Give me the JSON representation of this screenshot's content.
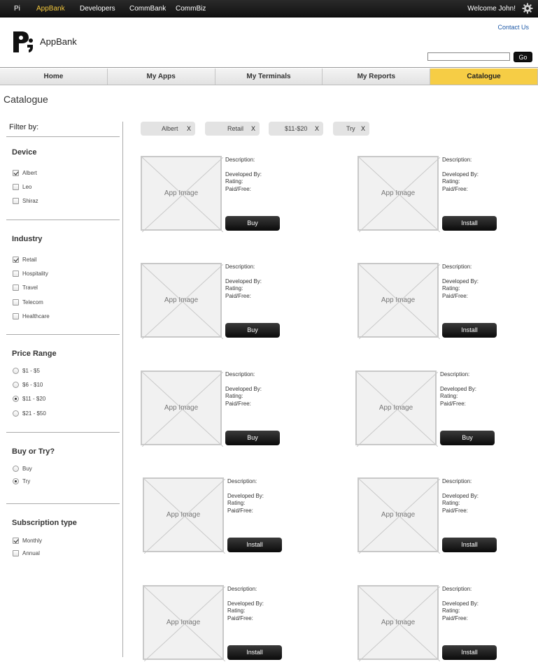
{
  "topnav": {
    "items": [
      {
        "label": "Pi",
        "active": false
      },
      {
        "label": "AppBank",
        "active": true
      },
      {
        "label": "Developers",
        "active": false
      },
      {
        "label": "CommBank",
        "active": false
      },
      {
        "label": "CommBiz",
        "active": false
      }
    ],
    "welcome": "Welcome John!",
    "settings_icon": "gear-icon"
  },
  "header": {
    "brand": "AppBank",
    "contact_link": "Contact Us",
    "search_placeholder": "",
    "go_label": "Go"
  },
  "tabs": [
    {
      "label": "Home",
      "active": false
    },
    {
      "label": "My Apps",
      "active": false
    },
    {
      "label": "My Terminals",
      "active": false
    },
    {
      "label": "My Reports",
      "active": false
    },
    {
      "label": "Catalogue",
      "active": true
    }
  ],
  "page_title": "Catalogue",
  "sidebar": {
    "filter_by": "Filter by:",
    "device": {
      "title": "Device",
      "options": [
        {
          "label": "Albert",
          "checked": true
        },
        {
          "label": "Leo",
          "checked": false
        },
        {
          "label": "Shiraz",
          "checked": false
        }
      ]
    },
    "industry": {
      "title": "Industry",
      "options": [
        {
          "label": "Retail",
          "checked": true
        },
        {
          "label": "Hospitality",
          "checked": false
        },
        {
          "label": "Travel",
          "checked": false
        },
        {
          "label": "Telecom",
          "checked": false
        },
        {
          "label": "Healthcare",
          "checked": false
        }
      ]
    },
    "price_range": {
      "title": "Price Range",
      "options": [
        {
          "label": "$1 - $5",
          "checked": false
        },
        {
          "label": "$6 - $10",
          "checked": false
        },
        {
          "label": "$11 - $20",
          "checked": true
        },
        {
          "label": "$21 - $50",
          "checked": false
        }
      ]
    },
    "buy_or_try": {
      "title": "Buy or Try?",
      "options": [
        {
          "label": "Buy",
          "checked": false
        },
        {
          "label": "Try",
          "checked": true
        }
      ]
    },
    "subscription": {
      "title": "Subscription type",
      "options": [
        {
          "label": "Monthly",
          "checked": true
        },
        {
          "label": "Annual",
          "checked": false
        }
      ]
    }
  },
  "active_filters": [
    {
      "label": "Albert",
      "remove": "X"
    },
    {
      "label": "Retail",
      "remove": "X"
    },
    {
      "label": "$11-$20",
      "remove": "X"
    },
    {
      "label": "Try",
      "remove": "X"
    }
  ],
  "apps": [
    {
      "image_label": "App Image",
      "description": "Description:",
      "developed_by": "Developed By:",
      "rating": "Rating:",
      "paid_free": "Paid/Free:",
      "button": "Buy"
    },
    {
      "image_label": "App Image",
      "description": "Description:",
      "developed_by": "Developed By:",
      "rating": "Rating:",
      "paid_free": "Paid/Free:",
      "button": "Install"
    },
    {
      "image_label": "App Image",
      "description": "Description:",
      "developed_by": "Developed By:",
      "rating": "Rating:",
      "paid_free": "Paid/Free:",
      "button": "Buy"
    },
    {
      "image_label": "App Image",
      "description": "Description:",
      "developed_by": "Developed By:",
      "rating": "Rating:",
      "paid_free": "Paid/Free:",
      "button": "Install"
    },
    {
      "image_label": "App Image",
      "description": "Description:",
      "developed_by": "Developed By:",
      "rating": "Rating:",
      "paid_free": "Paid/Free:",
      "button": "Buy"
    },
    {
      "image_label": "App Image",
      "description": "Description:",
      "developed_by": "Developed By:",
      "rating": "Rating:",
      "paid_free": "Paid/Free:",
      "button": "Buy"
    },
    {
      "image_label": "App Image",
      "description": "Description:",
      "developed_by": "Developed By:",
      "rating": "Rating:",
      "paid_free": "Paid/Free:",
      "button": "Install"
    },
    {
      "image_label": "App Image",
      "description": "Description:",
      "developed_by": "Developed By:",
      "rating": "Rating:",
      "paid_free": "Paid/Free:",
      "button": "Install"
    },
    {
      "image_label": "App Image",
      "description": "Description:",
      "developed_by": "Developed By:",
      "rating": "Rating:",
      "paid_free": "Paid/Free:",
      "button": "Install"
    },
    {
      "image_label": "App Image",
      "description": "Description:",
      "developed_by": "Developed By:",
      "rating": "Rating:",
      "paid_free": "Paid/Free:",
      "button": "Install"
    }
  ],
  "colors": {
    "accent": "#f6cd45",
    "topbar": "#1a1a1a",
    "active_nav": "#f4c83d",
    "link": "#1f5aa8"
  }
}
